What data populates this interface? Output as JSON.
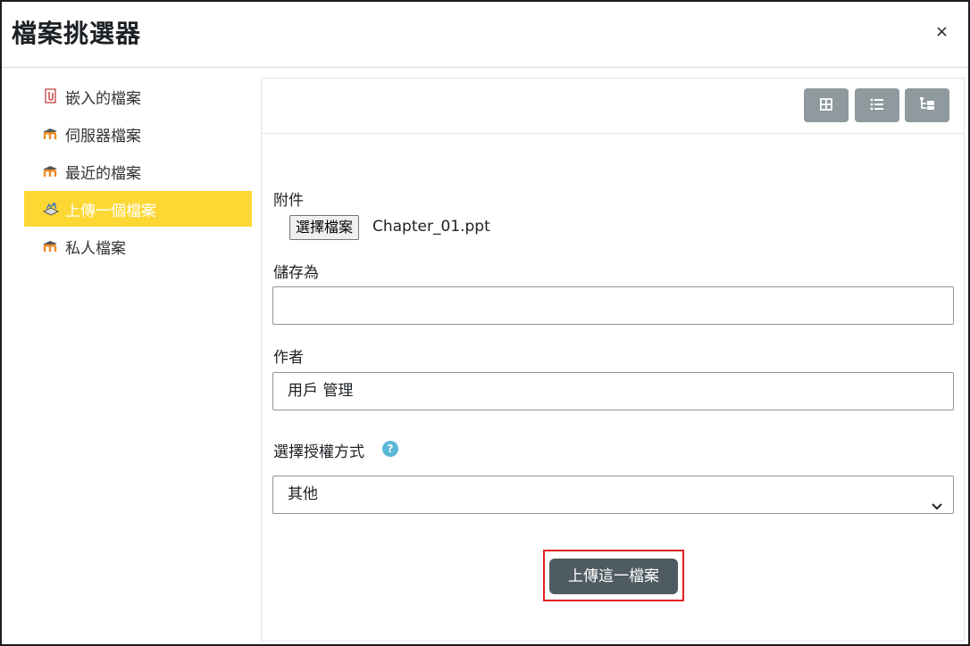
{
  "dialog": {
    "title": "檔案挑選器",
    "close_label": "×"
  },
  "sidebar": {
    "items": [
      {
        "label": "嵌入的檔案",
        "icon": "embedded-file-icon",
        "active": false
      },
      {
        "label": "伺服器檔案",
        "icon": "moodle-icon",
        "active": false
      },
      {
        "label": "最近的檔案",
        "icon": "moodle-icon",
        "active": false
      },
      {
        "label": "上傳一個檔案",
        "icon": "upload-icon",
        "active": true
      },
      {
        "label": "私人檔案",
        "icon": "moodle-icon",
        "active": false
      }
    ],
    "active_color": "#fdd835"
  },
  "toolbar": {
    "buttons": [
      {
        "icon": "grid-view-icon"
      },
      {
        "icon": "list-view-icon"
      },
      {
        "icon": "tree-view-icon"
      }
    ]
  },
  "form": {
    "attachment_label": "附件",
    "choose_file_label": "選擇檔案",
    "file_name": "Chapter_01.ppt",
    "save_as_label": "儲存為",
    "save_as_value": "",
    "author_label": "作者",
    "author_value": "用戶 管理",
    "license_label": "選擇授權方式",
    "help_icon": "?",
    "license_value": "其他",
    "upload_button_label": "上傳這一檔案"
  },
  "colors": {
    "button_gray": "#8e9a9d",
    "upload_button": "#4f5b62",
    "highlight": "#e02020",
    "help": "#5bb8d6"
  }
}
